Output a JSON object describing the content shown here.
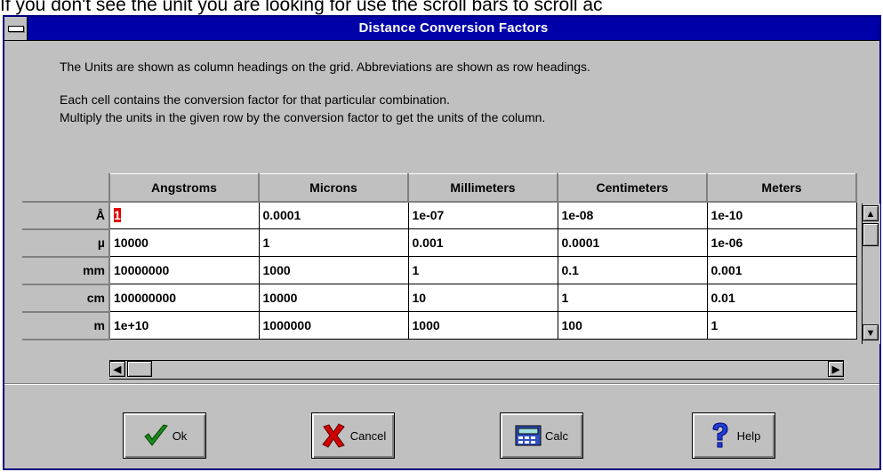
{
  "caption": "If you don't see the unit you are looking for use the scroll bars to scroll ac",
  "window": {
    "title": "Distance Conversion Factors"
  },
  "description": {
    "line1": "The Units are shown as column headings on the grid.  Abbreviations are shown as row headings.",
    "line2": "Each cell contains the conversion factor for that particular combination.",
    "line3": "Multiply the units in the given row by the conversion factor to get the units of the column."
  },
  "grid": {
    "columns": [
      "Angstroms",
      "Microns",
      "Millimeters",
      "Centimeters",
      "Meters"
    ],
    "rows": [
      {
        "abbr": "Å",
        "values": [
          "1",
          "0.0001",
          "1e-07",
          "1e-08",
          "1e-10"
        ]
      },
      {
        "abbr": "µ",
        "values": [
          "10000",
          "1",
          "0.001",
          "0.0001",
          "1e-06"
        ]
      },
      {
        "abbr": "mm",
        "values": [
          "10000000",
          "1000",
          "1",
          "0.1",
          "0.001"
        ]
      },
      {
        "abbr": "cm",
        "values": [
          "100000000",
          "10000",
          "10",
          "1",
          "0.01"
        ]
      },
      {
        "abbr": "m",
        "values": [
          "1e+10",
          "1000000",
          "1000",
          "100",
          "1"
        ]
      }
    ]
  },
  "buttons": {
    "ok": "Ok",
    "cancel": "Cancel",
    "calc": "Calc",
    "help": "Help"
  },
  "colors": {
    "title_bar": "#0000a8",
    "selected_cell": "#e00000"
  }
}
